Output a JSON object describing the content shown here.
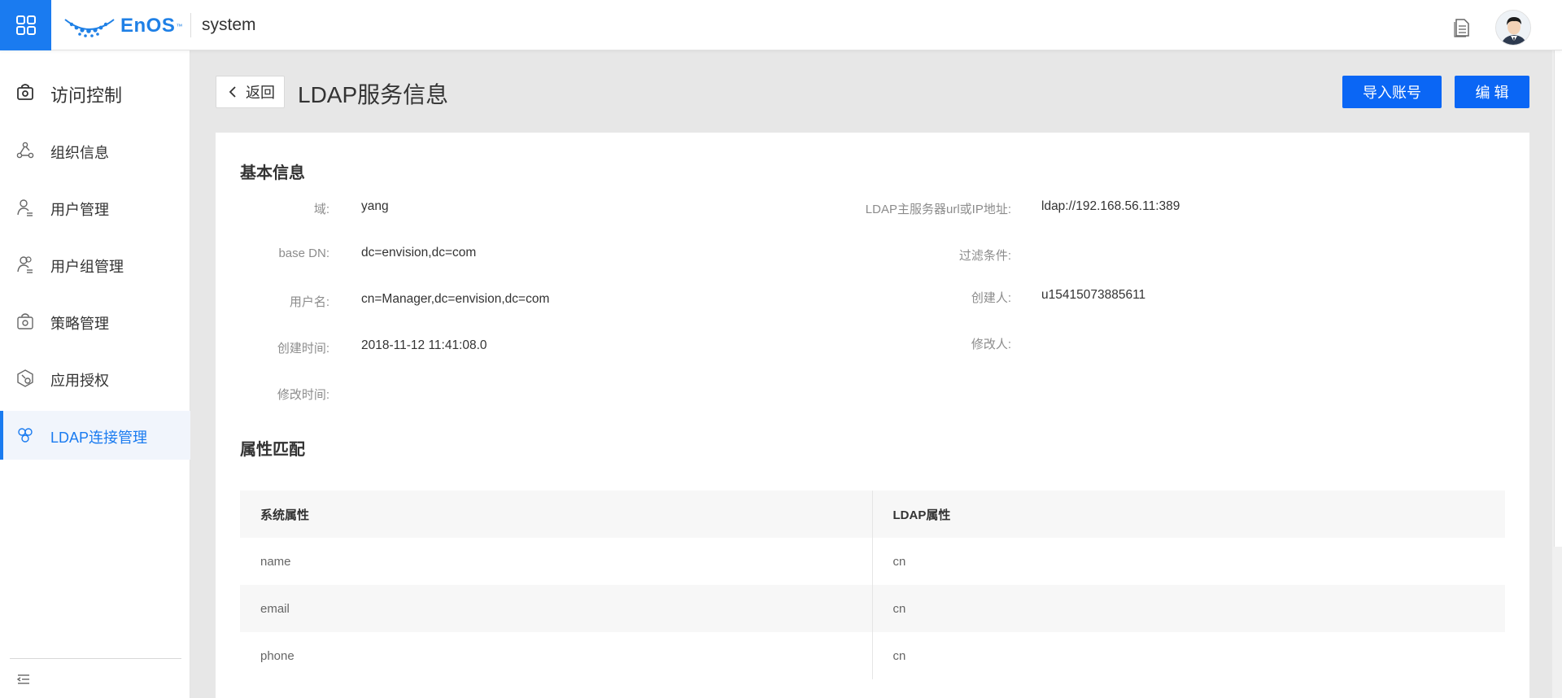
{
  "topbar": {
    "logo_text": "EnOS",
    "logo_tm": "™",
    "app_name": "system"
  },
  "sidebar": {
    "header": "访问控制",
    "items": [
      {
        "label": "组织信息",
        "icon": "org-icon"
      },
      {
        "label": "用户管理",
        "icon": "user-icon"
      },
      {
        "label": "用户组管理",
        "icon": "user-group-icon"
      },
      {
        "label": "策略管理",
        "icon": "policy-icon"
      },
      {
        "label": "应用授权",
        "icon": "app-auth-icon"
      },
      {
        "label": "LDAP连接管理",
        "icon": "ldap-icon"
      }
    ],
    "active_index": 5
  },
  "page": {
    "back_label": "返回",
    "title": "LDAP服务信息",
    "import_label": "导入账号",
    "edit_label": "编 辑"
  },
  "basic": {
    "title": "基本信息",
    "left": [
      {
        "label": "域:",
        "value": "yang"
      },
      {
        "label": "base DN:",
        "value": "dc=envision,dc=com"
      },
      {
        "label": "用户名:",
        "value": "cn=Manager,dc=envision,dc=com"
      },
      {
        "label": "创建时间:",
        "value": "2018-11-12 11:41:08.0"
      },
      {
        "label": "修改时间:",
        "value": ""
      }
    ],
    "right": [
      {
        "label": "LDAP主服务器url或IP地址:",
        "value": "ldap://192.168.56.11:389"
      },
      {
        "label": "过滤条件:",
        "value": ""
      },
      {
        "label": "创建人:",
        "value": "u15415073885611"
      },
      {
        "label": "修改人:",
        "value": ""
      }
    ]
  },
  "mapping": {
    "title": "属性匹配",
    "columns": [
      "系统属性",
      "LDAP属性"
    ],
    "rows": [
      [
        "name",
        "cn"
      ],
      [
        "email",
        "cn"
      ],
      [
        "phone",
        "cn"
      ]
    ]
  },
  "colors": {
    "primary": "#0a66f5",
    "sidebar_active": "#1a7bf0"
  }
}
